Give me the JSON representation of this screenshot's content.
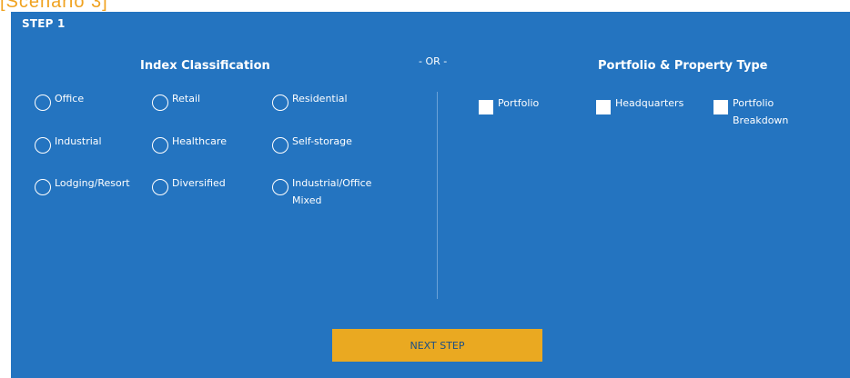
{
  "scenario": {
    "label": "[Scenario 3]"
  },
  "step": {
    "title": "STEP 1"
  },
  "or_label": "- OR -",
  "index_classification": {
    "title": "Index Classification",
    "options": [
      "Office",
      "Retail",
      "Residential",
      "Industrial",
      "Healthcare",
      "Self-storage",
      "Lodging/Resort",
      "Diversified",
      "Industrial/Office Mixed"
    ]
  },
  "portfolio_property": {
    "title": "Portfolio & Property Type",
    "options": [
      "Portfolio",
      "Headquarters",
      "Portfolio Breakdown"
    ]
  },
  "next_button": {
    "label": "NEXT STEP"
  },
  "colors": {
    "panel": "#2474c0",
    "accent": "#eaa921",
    "scenario_label": "#f0a21f",
    "button_text": "#1a4f86"
  }
}
